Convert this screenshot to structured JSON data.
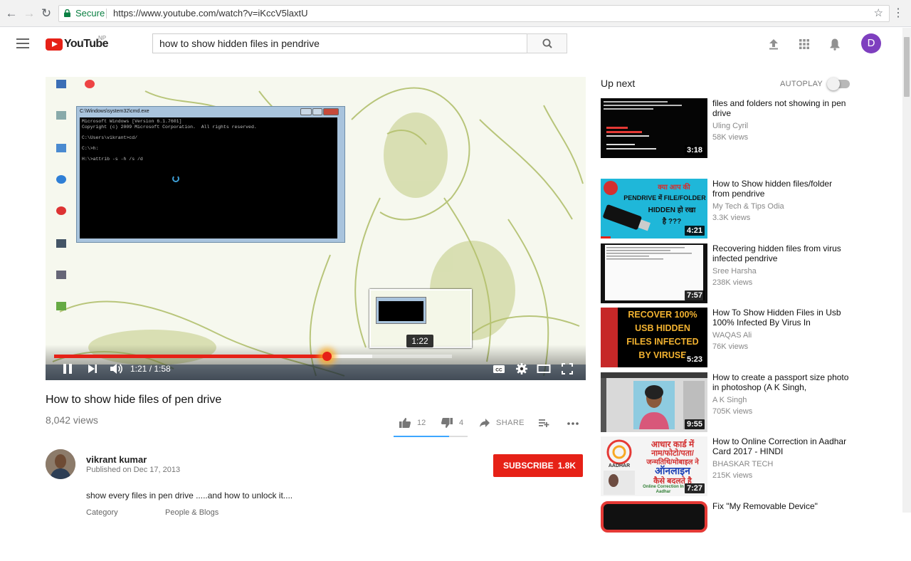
{
  "browser": {
    "secure_label": "Secure",
    "url": "https://www.youtube.com/watch?v=iKccV5laxtU"
  },
  "header": {
    "logo_text": "YouTube",
    "logo_region": "NP",
    "search_value": "how to show hidden files in pendrive",
    "avatar_letter": "D",
    "avatar_color": "#7e3fbf"
  },
  "player": {
    "current_time": "1:21",
    "duration": "1:58",
    "time_display": "1:21 / 1:58",
    "hover_time": "1:22",
    "progress_fraction": 0.686,
    "loaded_fraction": 0.8,
    "console_title": "C:\\Windows\\system32\\cmd.exe",
    "console_lines": "Microsoft Windows [Version 6.1.7601]\nCopyright (c) 2009 Microsoft Corporation.  All rights reserved.\n\nC:\\Users\\vikrant>cd/\n\nC:\\>h:\n\nH:\\>attrib -s -h /s /d",
    "desktop_icons": [
      "Computer",
      "Google Chrome",
      "Recycle Bin",
      "Control Panel",
      "Internet Explorer",
      "Kaspersky",
      "Recovery Logo Mode",
      "CamStudio",
      "FlashDrive"
    ]
  },
  "video": {
    "title": "How to show hide files of pen drive",
    "views": "8,042 views",
    "likes": "12",
    "dislikes": "4",
    "share_label": "SHARE",
    "like_fraction": 0.75
  },
  "channel": {
    "name": "vikrant kumar",
    "published": "Published on Dec 17, 2013",
    "subscribe_label": "SUBSCRIBE",
    "subscriber_count": "1.8K",
    "description": "show every files in pen drive .....and how to unlock it....",
    "category_label": "Category",
    "category_value": "People & Blogs"
  },
  "sidebar": {
    "up_next_label": "Up next",
    "autoplay_label": "AUTOPLAY",
    "autoplay_on": false,
    "items": [
      {
        "title": "files and folders not showing in pen drive",
        "channel": "Uling Cyril",
        "views": "58K views",
        "duration": "3:18"
      },
      {
        "title": "How to Show hidden files/folder from pendrive",
        "channel": "My Tech & Tips Odia",
        "views": "3.3K views",
        "duration": "4:21",
        "thumb_lines": [
          "क्या आप की",
          "PENDRIVE में FILE/FOLDER",
          "HIDDEN हो रखा",
          "है ???"
        ]
      },
      {
        "title": "Recovering hidden files from virus infected pendrive",
        "channel": "Sree Harsha",
        "views": "238K views",
        "duration": "7:57"
      },
      {
        "title": "How To Show Hidden Files in Usb 100% Infected By Virus In",
        "channel": "WAQAS Ali",
        "views": "76K views",
        "duration": "5:23",
        "thumb_lines": [
          "RECOVER 100%",
          "USB HIDDEN",
          "FILES INFECTED",
          "BY VIRUSE"
        ]
      },
      {
        "title": "How to create a passport size photo in photoshop (A K Singh,",
        "channel": "A K Singh",
        "views": "705K views",
        "duration": "9:55"
      },
      {
        "title": "How to Online Correction in Aadhar Card 2017 - HINDI",
        "channel": "BHASKAR TECH",
        "views": "215K views",
        "duration": "7:27",
        "thumb_lines": [
          "आधार कार्ड में",
          "नाम/फोटो/पता/",
          "जन्मतिथि/मोबाइल ने",
          "ऑनलाइन",
          "कैसे बदलते है",
          "AADHAR",
          "Online Correction In Aadhar"
        ]
      },
      {
        "title": "Fix \"My Removable Device\""
      }
    ]
  }
}
